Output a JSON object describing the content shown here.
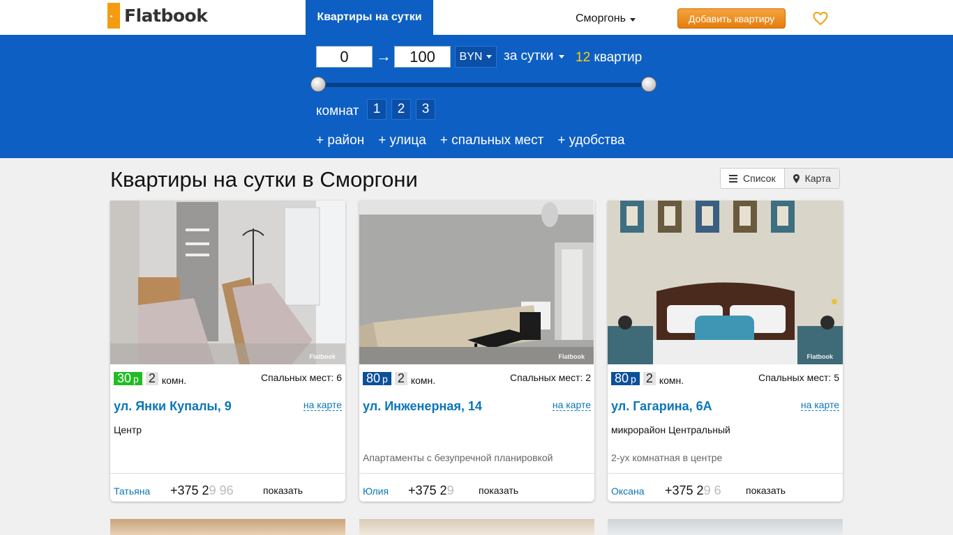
{
  "header": {
    "brand": "Flatbook",
    "nav_active": "Квартиры на сутки",
    "city": "Сморгонь",
    "add_button": "Добавить квартиру",
    "fav_icon": "heart-icon"
  },
  "filters": {
    "price_min": "0",
    "arrow": "→",
    "price_max": "100",
    "currency": "BYN",
    "period": "за сутки",
    "count_num": "12",
    "count_label": "квартир",
    "slider_min_fraction": 0,
    "slider_max_fraction": 1,
    "rooms_label": "комнат",
    "rooms": [
      "1",
      "2",
      "3"
    ],
    "more": [
      "+ район",
      "+ улица",
      "+ спальных мест",
      "+ удобства"
    ]
  },
  "page": {
    "title": "Квартиры на сутки в Сморгони",
    "view_list": "Список",
    "view_map": "Карта"
  },
  "cards": [
    {
      "price": "30",
      "price_unit": "р",
      "price_color": "#22bb22",
      "rooms": "2",
      "rooms_unit": "комн.",
      "beds": "Спальных мест: 6",
      "address": "ул. Янки Купалы, 9",
      "map_link": "на карте",
      "district": "Центр",
      "description": "",
      "owner": "Татьяна",
      "phone_visible": "+375 2",
      "phone_faded": "9 96",
      "show": "показать",
      "watermark": "Flatbook"
    },
    {
      "price": "80",
      "price_unit": "р",
      "price_color": "#0d4f99",
      "rooms": "2",
      "rooms_unit": "комн.",
      "beds": "Спальных мест: 2",
      "address": "ул. Инженерная, 14",
      "map_link": "на карте",
      "district": "",
      "description": "Апартаменты с безупречной планировкой",
      "owner": "Юлия",
      "phone_visible": "+375 2",
      "phone_faded": "9 ",
      "show": "показать",
      "watermark": "Flatbook"
    },
    {
      "price": "80",
      "price_unit": "р",
      "price_color": "#0d4f99",
      "rooms": "2",
      "rooms_unit": "комн.",
      "beds": "Спальных мест: 5",
      "address": "ул. Гагарина, 6А",
      "map_link": "на карте",
      "district": "микрорайон Центральный",
      "description": "2-ух комнатная в центре",
      "owner": "Оксана",
      "phone_visible": "+375 2",
      "phone_faded": "9 6",
      "show": "показать",
      "watermark": "Flatbook"
    }
  ]
}
